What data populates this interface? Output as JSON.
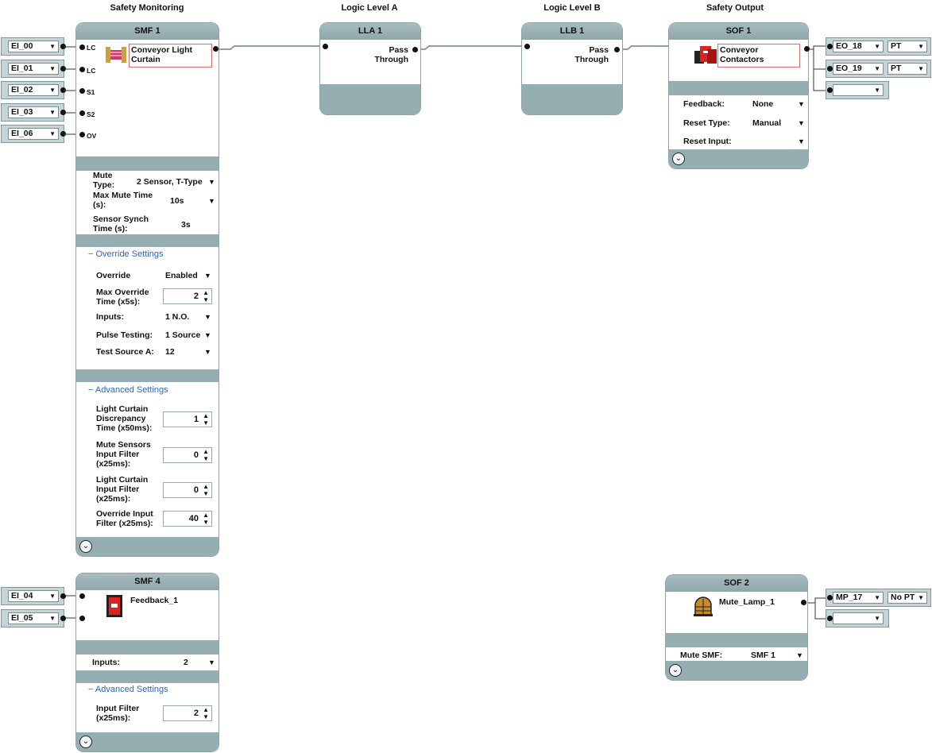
{
  "columns": {
    "safety_monitoring": "Safety Monitoring",
    "logic_a": "Logic Level A",
    "logic_b": "Logic Level B",
    "safety_output": "Safety Output"
  },
  "smf1": {
    "title": "SMF 1",
    "name": "Conveyor Light Curtain",
    "pins": [
      "LC",
      "LC",
      "S1",
      "S2",
      "OV"
    ],
    "inputs": [
      "EI_00",
      "EI_01",
      "EI_02",
      "EI_03",
      "EI_06"
    ],
    "mute_type_label": "Mute Type:",
    "mute_type_value": "2 Sensor, T-Type",
    "max_mute_label": "Max Mute Time (s):",
    "max_mute_value": "10s",
    "sensor_synch_label": "Sensor Synch Time (s):",
    "sensor_synch_value": "3s",
    "override_header": "Override Settings",
    "override_label": "Override",
    "override_value": "Enabled",
    "max_override_label": "Max Override Time (x5s):",
    "max_override_value": "2",
    "inputs_label": "Inputs:",
    "inputs_value": "1 N.O.",
    "pulse_label": "Pulse Testing:",
    "pulse_value": "1 Source",
    "test_source_label": "Test Source A:",
    "test_source_value": "12",
    "advanced_header": "Advanced Settings",
    "lc_disc_label": "Light Curtain Discrepancy Time (x50ms):",
    "lc_disc_value": "1",
    "mute_filter_label": "Mute Sensors Input Filter (x25ms):",
    "mute_filter_value": "0",
    "lc_filter_label": "Light Curtain Input Filter (x25ms):",
    "lc_filter_value": "0",
    "override_filter_label": "Override Input Filter (x25ms):",
    "override_filter_value": "40"
  },
  "lla1": {
    "title": "LLA 1",
    "func": "Pass Through"
  },
  "llb1": {
    "title": "LLB 1",
    "func": "Pass Through"
  },
  "sof1": {
    "title": "SOF 1",
    "name": "Conveyor Contactors",
    "outputs": [
      {
        "name": "EO_18",
        "pt": "PT"
      },
      {
        "name": "EO_19",
        "pt": "PT"
      },
      {
        "name": "",
        "pt": ""
      }
    ],
    "feedback_label": "Feedback:",
    "feedback_value": "None",
    "reset_type_label": "Reset Type:",
    "reset_type_value": "Manual",
    "reset_input_label": "Reset Input:",
    "reset_input_value": ""
  },
  "smf4": {
    "title": "SMF 4",
    "name": "Feedback_1",
    "inputs": [
      "EI_04",
      "EI_05"
    ],
    "inputs_label": "Inputs:",
    "inputs_value": "2",
    "advanced_header": "Advanced Settings",
    "filter_label": "Input Filter (x25ms):",
    "filter_value": "2"
  },
  "sof2": {
    "title": "SOF 2",
    "name": "Mute_Lamp_1",
    "outputs": [
      {
        "name": "MP_17",
        "pt": "No PT"
      },
      {
        "name": "",
        "pt": ""
      }
    ],
    "mute_smf_label": "Mute SMF:",
    "mute_smf_value": "SMF 1"
  },
  "colors": {
    "block_header": "#9db2b6",
    "band": "#95aeb2",
    "io_bg": "#c5d4d7",
    "link_blue": "#2a64c8",
    "name_border": "#e06a6a"
  },
  "icons": [
    "light-curtain-icon",
    "contactor-icon",
    "feedback-icon",
    "lamp-icon",
    "expand-icon",
    "dropdown-caret-icon",
    "spinner-icon"
  ]
}
